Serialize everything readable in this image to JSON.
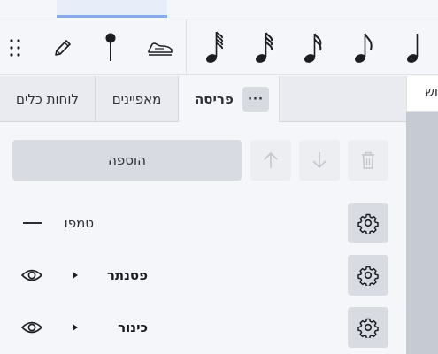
{
  "toolbar": {
    "tools": [
      {
        "name": "quarter-note-icon"
      },
      {
        "name": "eighth-note-icon"
      },
      {
        "name": "sixteenth-note-icon"
      },
      {
        "name": "thirty-second-note-icon"
      },
      {
        "name": "sixty-fourth-note-icon"
      },
      {
        "name": "slur-tie-icon"
      },
      {
        "name": "push-pin-icon"
      },
      {
        "name": "pencil-icon"
      },
      {
        "name": "drag-handle-icon"
      }
    ]
  },
  "panel": {
    "tabs": {
      "layout": "פריסה",
      "properties": "מאפיינים",
      "palettes": "לוחות כלים",
      "more": "···"
    },
    "add_button": "הוספה",
    "rows": [
      {
        "label": "טמפו"
      },
      {
        "label": "פסנתר"
      },
      {
        "label": "כינור"
      }
    ]
  },
  "right_panel": {
    "tab_partial": "וש"
  },
  "colors": {
    "accent": "#85acea",
    "panel_bg": "#f5f6fa",
    "button_bg": "#d8dbe2"
  }
}
